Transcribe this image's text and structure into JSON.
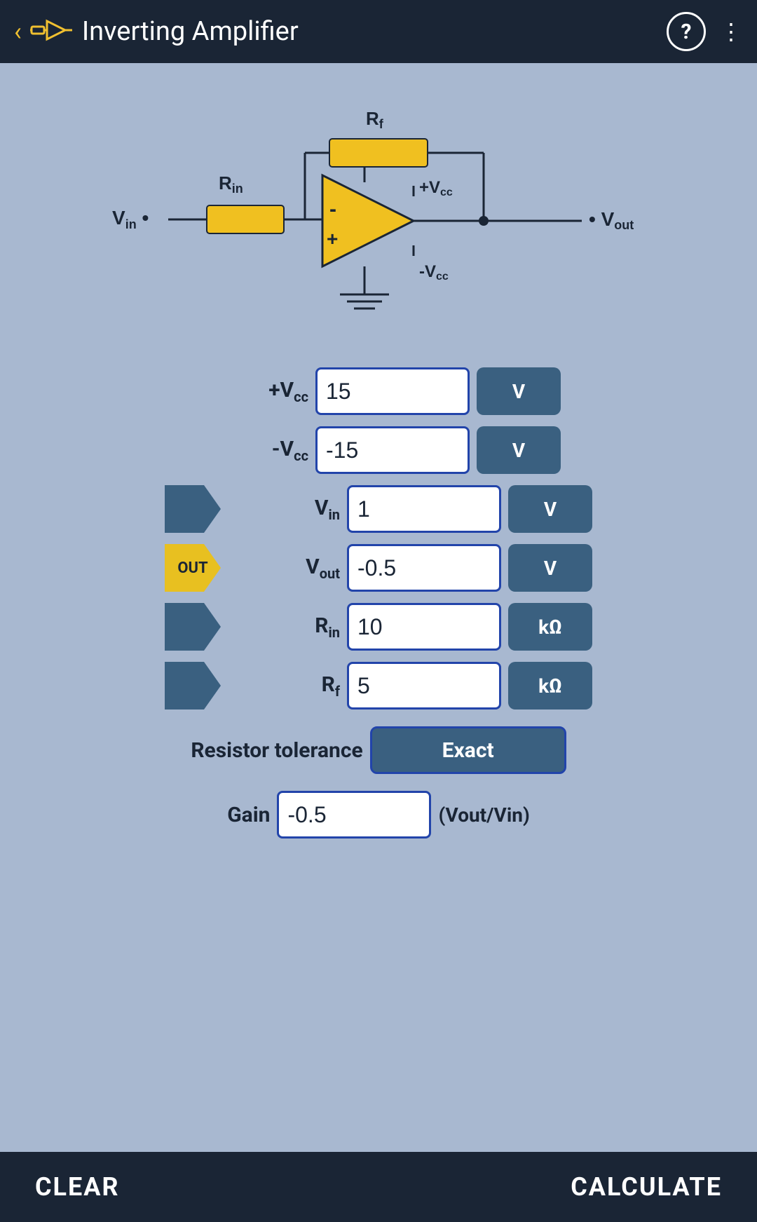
{
  "header": {
    "title": "Inverting Amplifier",
    "back_icon": "←",
    "help_label": "?",
    "menu_label": "⋮"
  },
  "circuit": {
    "labels": {
      "rf": "Rf",
      "rin": "Rin",
      "vin": "Vin",
      "vout": "Vout",
      "vcc_pos": "+Vcc",
      "vcc_neg": "-Vcc"
    }
  },
  "fields": {
    "vcc_pos": {
      "label": "+V",
      "label_sub": "cc",
      "value": "15",
      "unit": "V"
    },
    "vcc_neg": {
      "label": "-V",
      "label_sub": "cc",
      "value": "-15",
      "unit": "V"
    },
    "vin": {
      "label": "V",
      "label_sub": "in",
      "value": "1",
      "unit": "V"
    },
    "vout": {
      "label": "V",
      "label_sub": "out",
      "value": "-0.5",
      "unit": "V"
    },
    "rin": {
      "label": "R",
      "label_sub": "in",
      "value": "10",
      "unit": "kΩ"
    },
    "rf": {
      "label": "R",
      "label_sub": "f",
      "value": "5",
      "unit": "kΩ"
    }
  },
  "tolerance": {
    "label": "Resistor tolerance",
    "value": "Exact"
  },
  "gain": {
    "label": "Gain",
    "value": "-0.5",
    "unit": "(Vout/Vin)"
  },
  "bottom": {
    "clear_label": "CLEAR",
    "calculate_label": "CALCULATE"
  }
}
